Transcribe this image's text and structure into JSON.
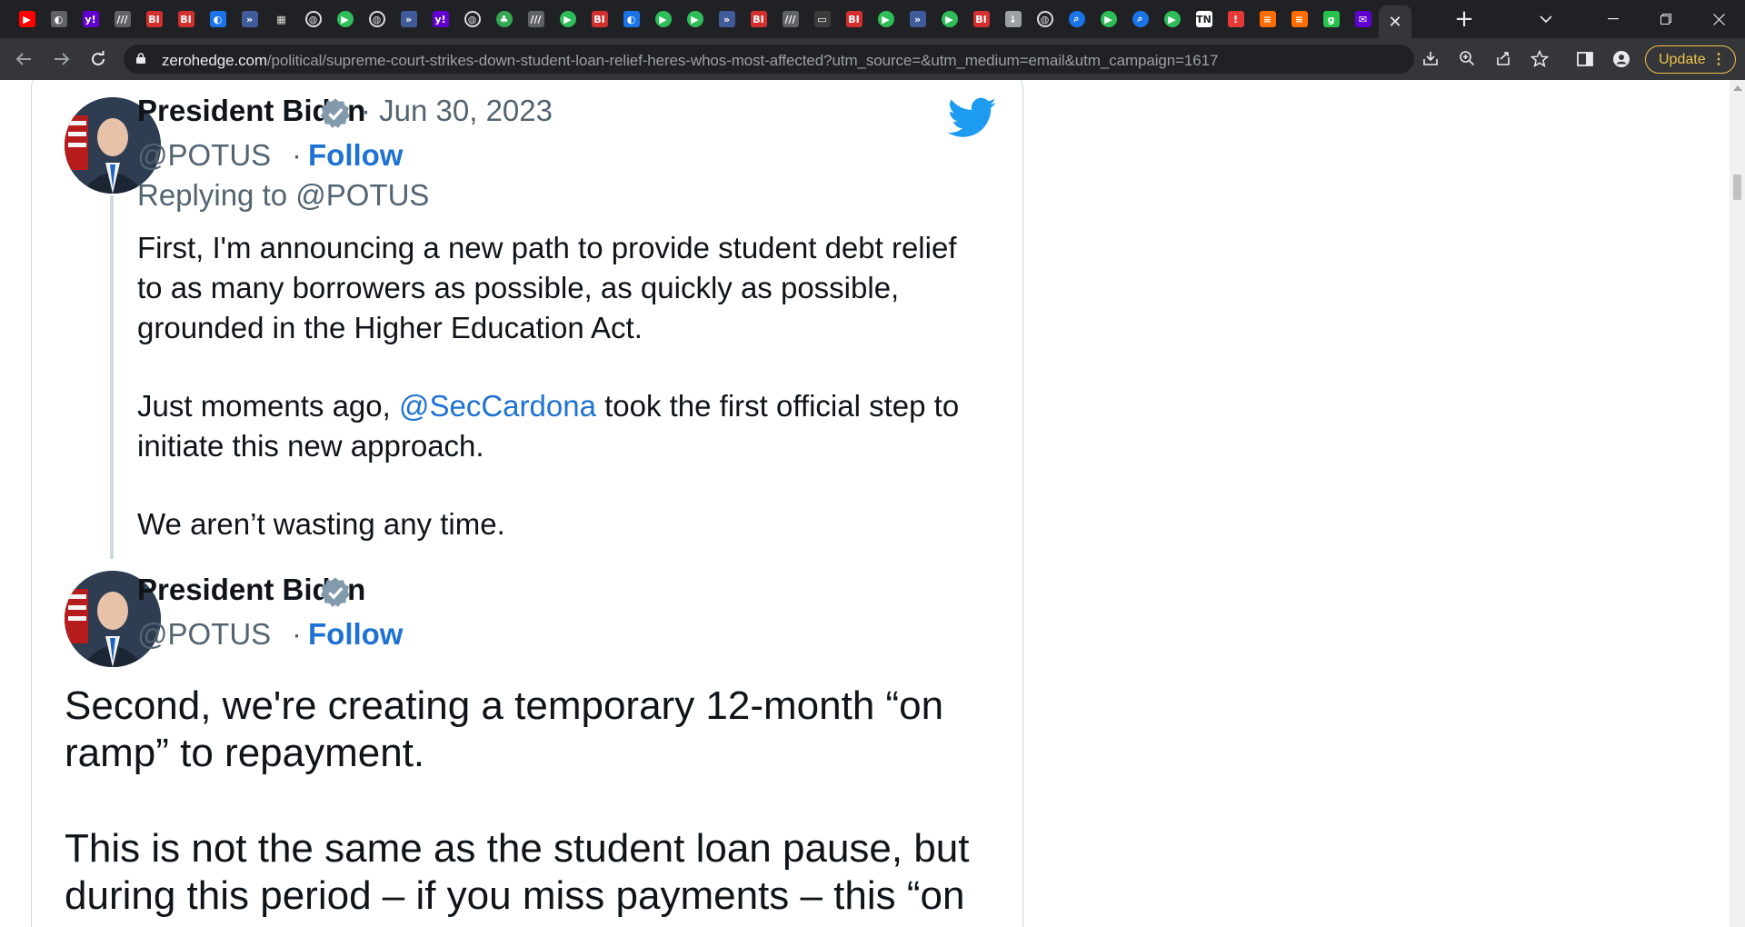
{
  "browser": {
    "tabs": [
      {
        "icon": "youtube-icon",
        "color": "#ff0000"
      },
      {
        "icon": "shield-icon",
        "color": "#5f6368"
      },
      {
        "icon": "yahoo-icon",
        "color": "#6001d2"
      },
      {
        "icon": "wsj-icon",
        "color": "#5f6368"
      },
      {
        "icon": "business-insider-icon",
        "color": "#d32f2f"
      },
      {
        "icon": "business-insider-icon",
        "color": "#d32f2f"
      },
      {
        "icon": "shield-icon",
        "color": "#1a73e8"
      },
      {
        "icon": "arrow-icon",
        "color": "#3f5b9a"
      },
      {
        "icon": "grid-icon",
        "color": "#e0e0e0"
      },
      {
        "icon": "globe-icon",
        "color": "#dadce0"
      },
      {
        "icon": "play-icon",
        "color": "#2ebd59"
      },
      {
        "icon": "globe-icon",
        "color": "#dadce0"
      },
      {
        "icon": "arrow-icon",
        "color": "#3f5b9a"
      },
      {
        "icon": "yahoo-icon",
        "color": "#6001d2"
      },
      {
        "icon": "globe-icon",
        "color": "#dadce0"
      },
      {
        "icon": "tree-icon",
        "color": "#34a853"
      },
      {
        "icon": "wsj-icon",
        "color": "#5f6368"
      },
      {
        "icon": "play-icon",
        "color": "#2ebd59"
      },
      {
        "icon": "business-insider-icon",
        "color": "#d32f2f"
      },
      {
        "icon": "shield-icon",
        "color": "#1a73e8"
      },
      {
        "icon": "play-icon",
        "color": "#2ebd59"
      },
      {
        "icon": "play-icon",
        "color": "#2ebd59"
      },
      {
        "icon": "arrow-icon",
        "color": "#3f5b9a"
      },
      {
        "icon": "business-insider-icon",
        "color": "#d32f2f"
      },
      {
        "icon": "wsj-icon",
        "color": "#5f6368"
      },
      {
        "icon": "page-icon",
        "color": "#3c3c3c"
      },
      {
        "icon": "business-insider-icon",
        "color": "#d32f2f"
      },
      {
        "icon": "play-icon",
        "color": "#2ebd59"
      },
      {
        "icon": "arrow-icon",
        "color": "#3f5b9a"
      },
      {
        "icon": "play-icon",
        "color": "#2ebd59"
      },
      {
        "icon": "business-insider-icon",
        "color": "#d32f2f"
      },
      {
        "icon": "download-icon",
        "color": "#9aa0a6"
      },
      {
        "icon": "globe-icon",
        "color": "#dadce0"
      },
      {
        "icon": "search-icon",
        "color": "#1a73e8"
      },
      {
        "icon": "play-icon",
        "color": "#2ebd59"
      },
      {
        "icon": "search-icon",
        "color": "#1a73e8"
      },
      {
        "icon": "play-icon",
        "color": "#2ebd59"
      },
      {
        "icon": "nyt-icon",
        "color": "#ffffff"
      },
      {
        "icon": "zerohedge-icon",
        "color": "#e53935"
      },
      {
        "icon": "bookmark-icon",
        "color": "#ff6d00"
      },
      {
        "icon": "bookmark-icon",
        "color": "#ff6d00"
      },
      {
        "icon": "g-icon",
        "color": "#27c24c"
      },
      {
        "icon": "mail-icon",
        "color": "#6001d2"
      }
    ],
    "address": {
      "domain": "zerohedge.com",
      "path": "/political/supreme-court-strikes-down-student-loan-relief-heres-whos-most-affected?utm_source=&utm_medium=email&utm_campaign=1617"
    },
    "update_label": "Update",
    "colors": {
      "frame": "#202124",
      "toolbar": "#35363a",
      "update_accent": "#f0c24b"
    }
  },
  "tweet1": {
    "name": "President Biden",
    "date": "· Jun 30, 2023",
    "handle": "@POTUS",
    "separator": "·",
    "follow": "Follow",
    "replying_to": "Replying to @POTUS",
    "lines": [
      "First, I'm announcing a new path to provide student debt relief",
      "to as many borrowers as possible, as quickly as possible,",
      "grounded in the Higher Education Act."
    ],
    "para2_before": "Just moments ago, ",
    "para2_mention": "@SecCardona",
    "para2_after": " took the first official step to",
    "para2_line2": "initiate this new approach.",
    "para3": "We aren’t wasting any time."
  },
  "tweet2": {
    "name": "President Biden",
    "handle": "@POTUS",
    "separator": "·",
    "follow": "Follow",
    "lines": [
      "Second, we're creating a temporary 12-month “on",
      "ramp” to repayment.",
      "",
      "This is not the same as the student loan pause, but",
      "during this period – if you miss payments – this “on"
    ]
  },
  "colors": {
    "twitter_blue": "#1d9bf0",
    "link": "#1d72d2",
    "verified": "#829aab",
    "text": "#0f1419",
    "muted": "#536471"
  }
}
